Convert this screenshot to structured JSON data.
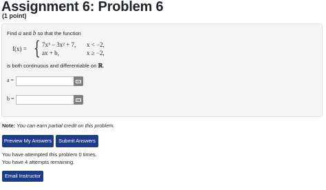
{
  "header": {
    "title": "Assignment 6: Problem 6",
    "points": "(1 point)"
  },
  "problem": {
    "intro_prefix": "Find ",
    "var_a": "a",
    "intro_and": " and ",
    "var_b": "b",
    "intro_suffix": " so that the function",
    "function_label": "f(x) =",
    "cases": [
      {
        "expr": "7x³ − 3x² + 7,",
        "condition": "x < −2,"
      },
      {
        "expr": "ax + b,",
        "condition": "x ≥ −2,"
      }
    ],
    "continuity_text": "is both continuous and differentiable on ",
    "reals_symbol": "ℝ",
    "continuity_end": "."
  },
  "answers": [
    {
      "label": "a =",
      "value": "",
      "placeholder": ""
    },
    {
      "label": "b =",
      "value": "",
      "placeholder": ""
    }
  ],
  "note": {
    "label": "Note:",
    "text": " You can earn partial credit on this problem."
  },
  "buttons": {
    "preview": "Preview My Answers",
    "submit": "Submit Answers",
    "email": "Email Instructor"
  },
  "status": {
    "attempted": "You have attempted this problem 0 times.",
    "remaining": "You have 4 attempts remaining."
  },
  "colors": {
    "button_bg": "#1c3b88",
    "panel_bg": "#f5f5f5",
    "preview_icon_bg": "#808080"
  }
}
